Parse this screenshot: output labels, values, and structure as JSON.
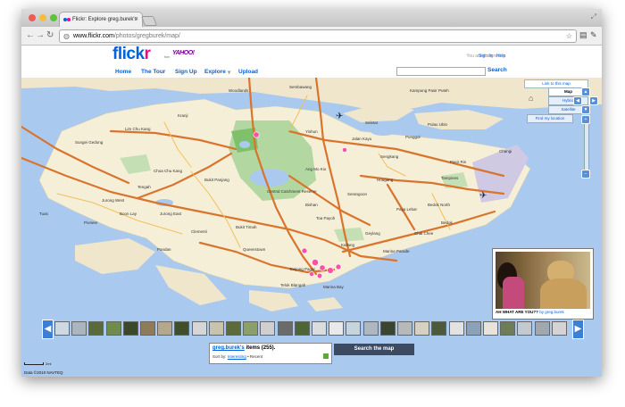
{
  "browser": {
    "tab_title": "Flickr: Explore greg.burek's",
    "tab_close": "×",
    "url_host": "www.flickr.com",
    "url_path": "/photos/gregburek/map/",
    "back_icon": "←",
    "forward_icon": "→",
    "reload_icon": "↻",
    "star_icon": "☆"
  },
  "header": {
    "logo_flick": "flick",
    "logo_r": "r",
    "logo_from": "from",
    "logo_yahoo": "YAHOO!",
    "signed_text": "You aren't signed in",
    "sign_in": "Sign In",
    "help": "Help",
    "nav": [
      "Home",
      "The Tour",
      "Sign Up",
      "Explore",
      "Upload"
    ],
    "search_button": "Search"
  },
  "map": {
    "link_text": "Link to this map",
    "types": [
      "Map",
      "Hybrid",
      "Satellite"
    ],
    "find_location": "Find my location",
    "labels": [
      "Lim Chu Kang",
      "Sungei Gedong",
      "Choa Chu Kang",
      "Bukit Panjang",
      "Central Catchment Reserve",
      "Woodlands",
      "Yishun",
      "Sembawang",
      "Jalan Kayu",
      "Seletar",
      "Sengkang",
      "Punggol",
      "Pasir Ris",
      "Tampines",
      "Changi",
      "Bedok",
      "Jurong West",
      "Jurong East",
      "Clementi",
      "Queenstown",
      "Bukit Timah",
      "Toa Payoh",
      "Serangoon",
      "Hougang",
      "Geylang",
      "Marine Parade",
      "Tuas",
      "Pioneer",
      "Boon Lay",
      "Pulau Ubin",
      "Kampung Pasir Puteh",
      "Kallang",
      "Tanjong Pagar",
      "Telok Blangah",
      "Pandan",
      "Paya Lebar",
      "Bedok North",
      "Chai Chee",
      "Marina Bay",
      "Ang Mo Kio",
      "Bishan",
      "Tengah",
      "Kranji"
    ],
    "photo_caption_title": "AH WHAT ARE YOU??",
    "photo_caption_by": "by greg.burek",
    "scale_text": "2mi",
    "copyright": "Data ©2010 NAVTEQ"
  },
  "panel": {
    "user_link": "greg.burek's",
    "items_text": "items (255).",
    "sort_label": "Sort by:",
    "sort_option": "Interesting",
    "sort_sep": "•",
    "sort_recent": "Recent",
    "search_map": "Search the map"
  },
  "thumb_colors": [
    "#cfd9e2",
    "#aab6bf",
    "#5b6a3a",
    "#6e8c4b",
    "#3a4a28",
    "#8f7a5a",
    "#b4a78b",
    "#3f4f2c",
    "#d6d6d6",
    "#c9c2ad",
    "#5d6a3b",
    "#8aa069",
    "#cfcfcf",
    "#6b6b6b",
    "#4c6636",
    "#dcdcdc",
    "#e9e9e9",
    "#c6d4de",
    "#aeb6c0",
    "#3a4531",
    "#b8b8b8",
    "#d8d0c0",
    "#4c5a3c",
    "#e2e2e2",
    "#8aa1b8",
    "#e9e3da",
    "#6c7d58",
    "#c3c9cf",
    "#a0a8ae",
    "#d4d4d4"
  ]
}
